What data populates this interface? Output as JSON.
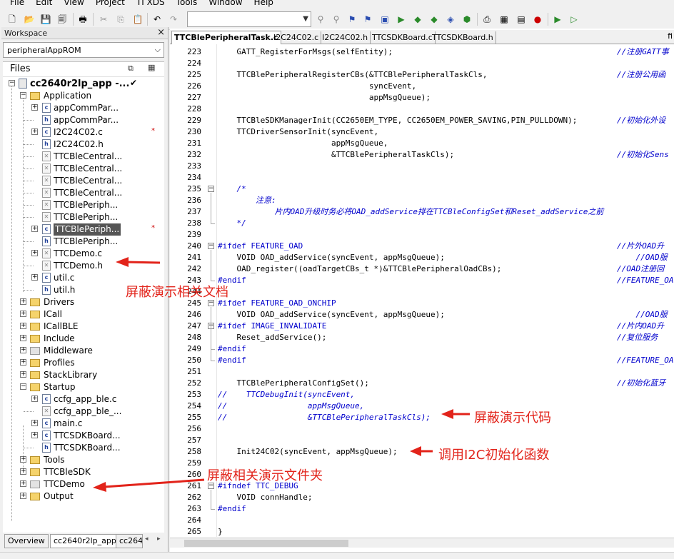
{
  "menu": [
    "File",
    "Edit",
    "View",
    "Project",
    "TI XDS",
    "Tools",
    "Window",
    "Help"
  ],
  "workspace": {
    "title": "Workspace",
    "close": "×",
    "config": "peripheralAppROM",
    "files_label": "Files",
    "project": "cc2640r2lp_app -...",
    "project_check": "✔",
    "tabs": [
      "Overview",
      "cc2640r2lp_app",
      "cc264"
    ]
  },
  "tree": [
    {
      "label": "Application",
      "type": "folder",
      "level": 1,
      "exp": "−"
    },
    {
      "label": "appCommPar...",
      "type": "c",
      "level": 2,
      "exp": "+"
    },
    {
      "label": "appCommPar...",
      "type": "h",
      "level": 2,
      "exp": ""
    },
    {
      "label": "I2C24C02.c",
      "type": "c",
      "level": 2,
      "exp": "+",
      "mark": "*"
    },
    {
      "label": "I2C24C02.h",
      "type": "h",
      "level": 2,
      "exp": ""
    },
    {
      "label": "TTCBleCentral...",
      "type": "cx",
      "level": 2,
      "exp": ""
    },
    {
      "label": "TTCBleCentral...",
      "type": "cx",
      "level": 2,
      "exp": ""
    },
    {
      "label": "TTCBleCentral...",
      "type": "cx",
      "level": 2,
      "exp": ""
    },
    {
      "label": "TTCBleCentral...",
      "type": "cx",
      "level": 2,
      "exp": ""
    },
    {
      "label": "TTCBlePeriph...",
      "type": "cx",
      "level": 2,
      "exp": ""
    },
    {
      "label": "TTCBlePeriph...",
      "type": "cx",
      "level": 2,
      "exp": ""
    },
    {
      "label": "TTCBlePeriph...",
      "type": "c",
      "level": 2,
      "exp": "+",
      "mark": "*",
      "selected": true
    },
    {
      "label": "TTCBlePeriph...",
      "type": "h",
      "level": 2,
      "exp": ""
    },
    {
      "label": "TTCDemo.c",
      "type": "cx",
      "level": 2,
      "exp": "+"
    },
    {
      "label": "TTCDemo.h",
      "type": "cx",
      "level": 2,
      "exp": ""
    },
    {
      "label": "util.c",
      "type": "c",
      "level": 2,
      "exp": "+"
    },
    {
      "label": "util.h",
      "type": "h",
      "level": 2,
      "exp": ""
    },
    {
      "label": "Drivers",
      "type": "folder",
      "level": 1,
      "exp": "+"
    },
    {
      "label": "ICall",
      "type": "folder",
      "level": 1,
      "exp": "+"
    },
    {
      "label": "ICallBLE",
      "type": "folder",
      "level": 1,
      "exp": "+"
    },
    {
      "label": "Include",
      "type": "folder",
      "level": 1,
      "exp": "+"
    },
    {
      "label": "Middleware",
      "type": "folderx",
      "level": 1,
      "exp": "+"
    },
    {
      "label": "Profiles",
      "type": "folder",
      "level": 1,
      "exp": "+"
    },
    {
      "label": "StackLibrary",
      "type": "folder",
      "level": 1,
      "exp": "+"
    },
    {
      "label": "Startup",
      "type": "folder",
      "level": 1,
      "exp": "−"
    },
    {
      "label": "ccfg_app_ble.c",
      "type": "c",
      "level": 2,
      "exp": "+"
    },
    {
      "label": "ccfg_app_ble_...",
      "type": "cx",
      "level": 2,
      "exp": ""
    },
    {
      "label": "main.c",
      "type": "c",
      "level": 2,
      "exp": "+"
    },
    {
      "label": "TTCSDKBoard...",
      "type": "c",
      "level": 2,
      "exp": "+"
    },
    {
      "label": "TTCSDKBoard...",
      "type": "h",
      "level": 2,
      "exp": ""
    },
    {
      "label": "Tools",
      "type": "folder",
      "level": 1,
      "exp": "+"
    },
    {
      "label": "TTCBleSDK",
      "type": "folder",
      "level": 1,
      "exp": "+"
    },
    {
      "label": "TTCDemo",
      "type": "folderx",
      "level": 1,
      "exp": "+"
    },
    {
      "label": "Output",
      "type": "folder",
      "level": 1,
      "exp": "+"
    }
  ],
  "editor": {
    "tabs": [
      "TTCBlePeripheralTask.c",
      "I2C24C02.c",
      "I2C24C02.h",
      "TTCSDKBoard.c",
      "TTCSDKBoard.h"
    ],
    "corner": "fi",
    "lines": [
      {
        "n": "223",
        "code": "    GATT_RegisterForMsgs(selfEntity);",
        "cm": "//注册GATT事"
      },
      {
        "n": "224",
        "code": ""
      },
      {
        "n": "225",
        "code": "    TTCBlePeripheralRegisterCBs(&TTCBlePeripheralTaskCls,",
        "cm": "//注册公用函"
      },
      {
        "n": "226",
        "code": "                                syncEvent,"
      },
      {
        "n": "227",
        "code": "                                appMsgQueue);"
      },
      {
        "n": "228",
        "code": ""
      },
      {
        "n": "229",
        "code": "    TTCBleSDKManagerInit(CC2650EM_TYPE, CC2650EM_POWER_SAVING,PIN_PULLDOWN);",
        "cm": "//初始化外设"
      },
      {
        "n": "230",
        "code": "    TTCDriverSensorInit(syncEvent,"
      },
      {
        "n": "231",
        "code": "                        appMsgQueue,"
      },
      {
        "n": "232",
        "code": "                        &TTCBlePeripheralTaskCls);",
        "cm": "//初始化Sens"
      },
      {
        "n": "233",
        "code": ""
      },
      {
        "n": "234",
        "code": ""
      },
      {
        "n": "235",
        "code": "    /*",
        "type": "cm",
        "fold": "−"
      },
      {
        "n": "236",
        "code": "        注意:",
        "type": "cm"
      },
      {
        "n": "237",
        "code": "            片内OAD升级时务必将OAD_addService排在TTCBleConfigSet和Reset_addService之前",
        "type": "cm"
      },
      {
        "n": "238",
        "code": "    */",
        "type": "cm"
      },
      {
        "n": "239",
        "code": ""
      },
      {
        "n": "240",
        "code": "#ifdef FEATURE_OAD",
        "type": "pp",
        "fold": "−",
        "cm": "//片外OAD升"
      },
      {
        "n": "241",
        "code": "    VOID OAD_addService(syncEvent, appMsgQueue);",
        "cm": "    //OAD服"
      },
      {
        "n": "242",
        "code": "    OAD_register((oadTargetCBs_t *)&TTCBlePeripheralOadCBs);",
        "cm": "//OAD注册回"
      },
      {
        "n": "243",
        "code": "#endif",
        "type": "pp",
        "cm": "//FEATURE_OA"
      },
      {
        "n": "244",
        "code": ""
      },
      {
        "n": "245",
        "code": "#ifdef FEATURE_OAD_ONCHIP",
        "type": "pp",
        "fold": "−"
      },
      {
        "n": "246",
        "code": "    VOID OAD_addService(syncEvent, appMsgQueue);",
        "cm": "    //OAD服"
      },
      {
        "n": "247",
        "code": "#ifdef IMAGE_INVALIDATE",
        "type": "pp",
        "fold": "−",
        "cm": "//片内OAD升"
      },
      {
        "n": "248",
        "code": "    Reset_addService();",
        "cm": "//复位服务"
      },
      {
        "n": "249",
        "code": "#endif",
        "type": "pp"
      },
      {
        "n": "250",
        "code": "#endif",
        "type": "pp",
        "cm": "//FEATURE_OA"
      },
      {
        "n": "251",
        "code": ""
      },
      {
        "n": "252",
        "code": "    TTCBlePeripheralConfigSet();",
        "cm": "//初始化蓝牙"
      },
      {
        "n": "253",
        "code": "//    TTCDebugInit(syncEvent,",
        "type": "cm"
      },
      {
        "n": "254",
        "code": "//                 appMsgQueue,",
        "type": "cm"
      },
      {
        "n": "255",
        "code": "//                 &TTCBlePeripheralTaskCls);",
        "type": "cm"
      },
      {
        "n": "256",
        "code": ""
      },
      {
        "n": "257",
        "code": ""
      },
      {
        "n": "258",
        "code": "    Init24C02(syncEvent, appMsgQueue);"
      },
      {
        "n": "259",
        "code": ""
      },
      {
        "n": "260",
        "code": ""
      },
      {
        "n": "261",
        "code": "#ifndef TTC_DEBUG",
        "type": "pp",
        "fold": "−"
      },
      {
        "n": "262",
        "code": "    VOID connHandle;"
      },
      {
        "n": "263",
        "code": "#endif",
        "type": "pp"
      },
      {
        "n": "264",
        "code": ""
      },
      {
        "n": "265",
        "code": "}"
      }
    ]
  },
  "annotations": {
    "docs": "屏蔽演示相关文档",
    "code": "屏蔽演示代码",
    "i2c": "调用I2C初始化函数",
    "folder": "屏蔽相关演示文件夹",
    "color": "#e2231a"
  }
}
